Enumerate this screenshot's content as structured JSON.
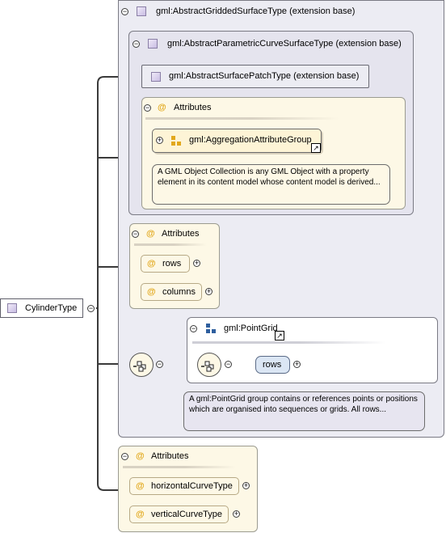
{
  "root": {
    "label": "CylinderType",
    "toggle": "−"
  },
  "base_outer": {
    "label": "gml:AbstractGriddedSurfaceType (extension base)",
    "toggle": "−"
  },
  "base_inner": {
    "label": "gml:AbstractParametricCurveSurfaceType (extension base)",
    "toggle": "−"
  },
  "patch_type": {
    "label": "gml:AbstractSurfacePatchType (extension base)"
  },
  "attr_group_1": {
    "title": "Attributes",
    "at": "@",
    "toggle": "−",
    "ref_label": "gml:AggregationAttributeGroup",
    "ref_toggle": "+",
    "link_glyph": "↗",
    "note": "A GML Object Collection is any GML Object with a property element in its content model whose content model is derived..."
  },
  "attr_group_2": {
    "title": "Attributes",
    "at": "@",
    "toggle": "−",
    "items": [
      {
        "label": "rows",
        "toggle": "+"
      },
      {
        "label": "columns",
        "toggle": "+"
      }
    ]
  },
  "point_grid": {
    "label": "gml:PointGrid",
    "toggle": "−",
    "link_glyph": "↗",
    "inner_toggle": "−",
    "outer_seq_toggle": "−",
    "element": {
      "label": "rows",
      "toggle": "+"
    },
    "note": "A gml:PointGrid group contains or references points or positions which are organised into sequences or grids. All rows..."
  },
  "attr_group_3": {
    "title": "Attributes",
    "at": "@",
    "toggle": "−",
    "items": [
      {
        "label": "horizontalCurveType",
        "toggle": "+"
      },
      {
        "label": "verticalCurveType",
        "toggle": "+"
      }
    ]
  },
  "colors": {
    "purple_bg": "#ececf3",
    "cream_bg": "#fdf8e6",
    "attr_at": "#e2a81c",
    "element_bg": "#dbe6f4",
    "note_purple": "#e7e5f0"
  }
}
